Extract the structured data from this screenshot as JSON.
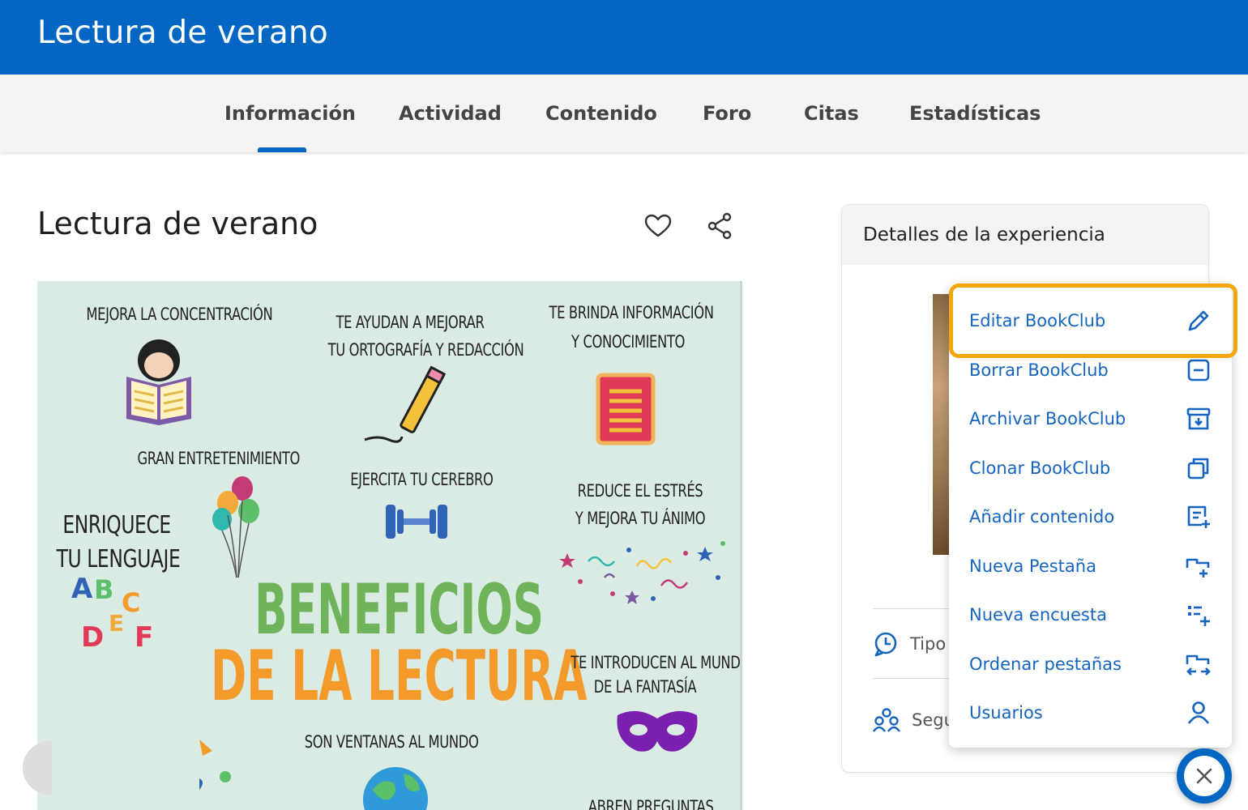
{
  "header": {
    "title": "Lectura de verano"
  },
  "tabs": [
    {
      "label": "Información",
      "active": true
    },
    {
      "label": "Actividad"
    },
    {
      "label": "Contenido"
    },
    {
      "label": "Foro"
    },
    {
      "label": "Citas"
    },
    {
      "label": "Estadísticas"
    }
  ],
  "page": {
    "title": "Lectura de verano",
    "actions": {
      "favorite_icon": "heart-icon",
      "share_icon": "share-icon"
    }
  },
  "poster": {
    "captions": {
      "concentracion": "MEJORA LA CONCENTRACIÓN",
      "ortografia_1": "TE AYUDAN A MEJORAR",
      "ortografia_2": "TU ORTOGRAFÍA Y REDACCIÓN",
      "informacion_1": "TE BRINDA INFORMACIÓN",
      "informacion_2": "Y CONOCIMIENTO",
      "entretenimiento": "GRAN ENTRETENIMIENTO",
      "cerebro": "EJERCITA TU CEREBRO",
      "estres_1": "REDUCE EL ESTRÉS",
      "estres_2": "Y MEJORA TU ÁNIMO",
      "lenguaje_1": "ENRIQUECE",
      "lenguaje_2": "TU LENGUAJE",
      "letters": [
        "A",
        "B",
        "C",
        "D",
        "E",
        "F"
      ],
      "title_1": "BENEFICIOS",
      "title_2": "DE LA LECTURA",
      "fantasia_1": "TE INTRODUCEN AL MUNDO",
      "fantasia_2": "DE LA FANTASÍA",
      "ventanas": "SON VENTANAS AL MUNDO",
      "preguntas": "ABREN PREGUNTAS"
    },
    "colors": {
      "background": "#d9ebe3",
      "title_green": "#6fb35a",
      "title_orange": "#f39a2b"
    }
  },
  "details": {
    "title": "Detalles de la experiencia",
    "rows": [
      {
        "icon": "chat-history-icon",
        "label": "Tipo"
      },
      {
        "icon": "group-icon",
        "label": "Segu"
      }
    ]
  },
  "menu": {
    "items": [
      {
        "label": "Editar BookClub",
        "icon": "pencil-icon",
        "highlighted": true
      },
      {
        "label": "Borrar BookClub",
        "icon": "delete-box-icon"
      },
      {
        "label": "Archivar BookClub",
        "icon": "archive-icon"
      },
      {
        "label": "Clonar BookClub",
        "icon": "clone-icon"
      },
      {
        "label": "Añadir contenido",
        "icon": "add-content-icon"
      },
      {
        "label": "Nueva Pestaña",
        "icon": "new-tab-icon"
      },
      {
        "label": "Nueva encuesta",
        "icon": "new-survey-icon"
      },
      {
        "label": "Ordenar pestañas",
        "icon": "sort-tabs-icon"
      },
      {
        "label": "Usuarios",
        "icon": "user-icon"
      }
    ],
    "highlight_color": "#f4a60b"
  },
  "colors": {
    "brand": "#0366c3",
    "menu_text": "#1565c0"
  },
  "close_button": {
    "icon": "close-icon"
  }
}
